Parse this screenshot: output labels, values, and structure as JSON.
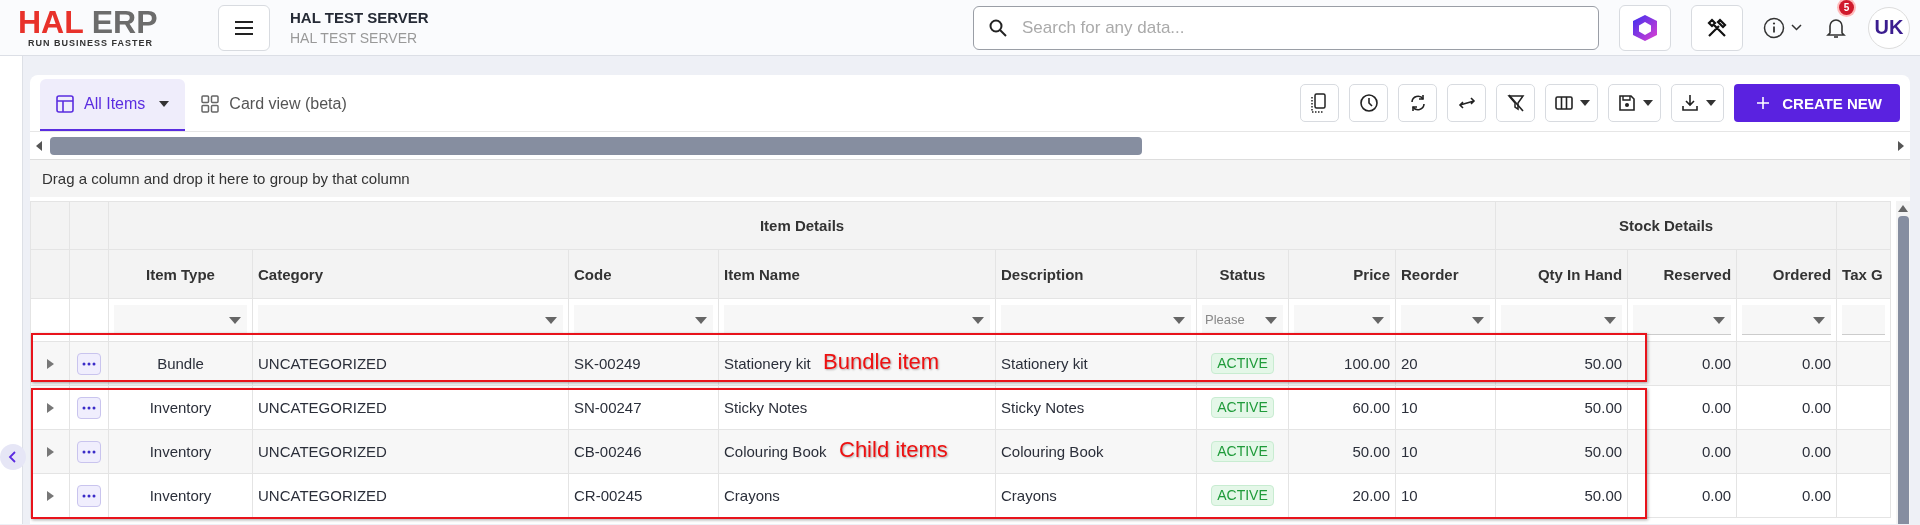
{
  "header": {
    "logo": {
      "part_1": "HAL",
      "part_2": "ERP",
      "tagline": "RUN BUSINESS FASTER"
    },
    "server": {
      "title": "HAL TEST SERVER",
      "subtitle": "HAL TEST SERVER"
    },
    "search": {
      "placeholder": "Search for any data..."
    },
    "notifications": {
      "count": "5"
    },
    "avatar": {
      "initials": "UK"
    }
  },
  "tabs": [
    {
      "label": "All Items",
      "selected": true,
      "kind": "table",
      "dropdown": true
    },
    {
      "label": "Card view (beta)",
      "selected": false,
      "kind": "grid",
      "dropdown": false
    }
  ],
  "toolbar": [
    {
      "kind": "page",
      "dropdown": false
    },
    {
      "kind": "clock",
      "dropdown": false
    },
    {
      "kind": "refresh",
      "dropdown": false
    },
    {
      "kind": "swap",
      "dropdown": false
    },
    {
      "kind": "filter-off",
      "dropdown": false
    },
    {
      "kind": "columns",
      "dropdown": true
    },
    {
      "kind": "save",
      "dropdown": true
    },
    {
      "kind": "download",
      "dropdown": true
    }
  ],
  "create_button": {
    "label": "CREATE NEW"
  },
  "group_panel": {
    "text": "Drag a column and drop it here to group by that column"
  },
  "table": {
    "column_groups": [
      {
        "label": "Item Details",
        "columns": [
          {
            "label": "Item Type",
            "kind": "center"
          },
          {
            "label": "Category",
            "kind": "text"
          },
          {
            "label": "Code",
            "kind": "text"
          },
          {
            "label": "Item Name",
            "kind": "text"
          },
          {
            "label": "Description",
            "kind": "text"
          },
          {
            "label": "Status",
            "kind": "status",
            "filter_placeholder": "Please"
          },
          {
            "label": "Price",
            "kind": "amount"
          },
          {
            "label": "Reorder",
            "kind": "text"
          }
        ]
      },
      {
        "label": "Stock Details",
        "columns": [
          {
            "label": "Qty In Hand",
            "kind": "amount"
          },
          {
            "label": "Reserved",
            "kind": "amount"
          },
          {
            "label": "Ordered",
            "kind": "amount"
          }
        ]
      },
      {
        "columns": [
          {
            "label": "Tax G",
            "kind": "text"
          }
        ]
      }
    ],
    "rows": [
      {
        "cells": [
          "Bundle",
          "UNCATEGORIZED",
          "SK-00249",
          "Stationery kit",
          "Stationery kit",
          "ACTIVE",
          "100.00",
          "20",
          "50.00",
          "0.00",
          "0.00"
        ]
      },
      {
        "cells": [
          "Inventory",
          "UNCATEGORIZED",
          "SN-00247",
          "Sticky Notes",
          "Sticky Notes",
          "ACTIVE",
          "60.00",
          "10",
          "50.00",
          "0.00",
          "0.00"
        ]
      },
      {
        "cells": [
          "Inventory",
          "UNCATEGORIZED",
          "CB-00246",
          "Colouring Book",
          "Colouring Book",
          "ACTIVE",
          "50.00",
          "10",
          "50.00",
          "0.00",
          "0.00"
        ]
      },
      {
        "cells": [
          "Inventory",
          "UNCATEGORIZED",
          "CR-00245",
          "Crayons",
          "Crayons",
          "ACTIVE",
          "20.00",
          "10",
          "50.00",
          "0.00",
          "0.00"
        ]
      }
    ]
  },
  "annotations": [
    {
      "label": "Bundle item"
    },
    {
      "label": "Child items"
    }
  ]
}
